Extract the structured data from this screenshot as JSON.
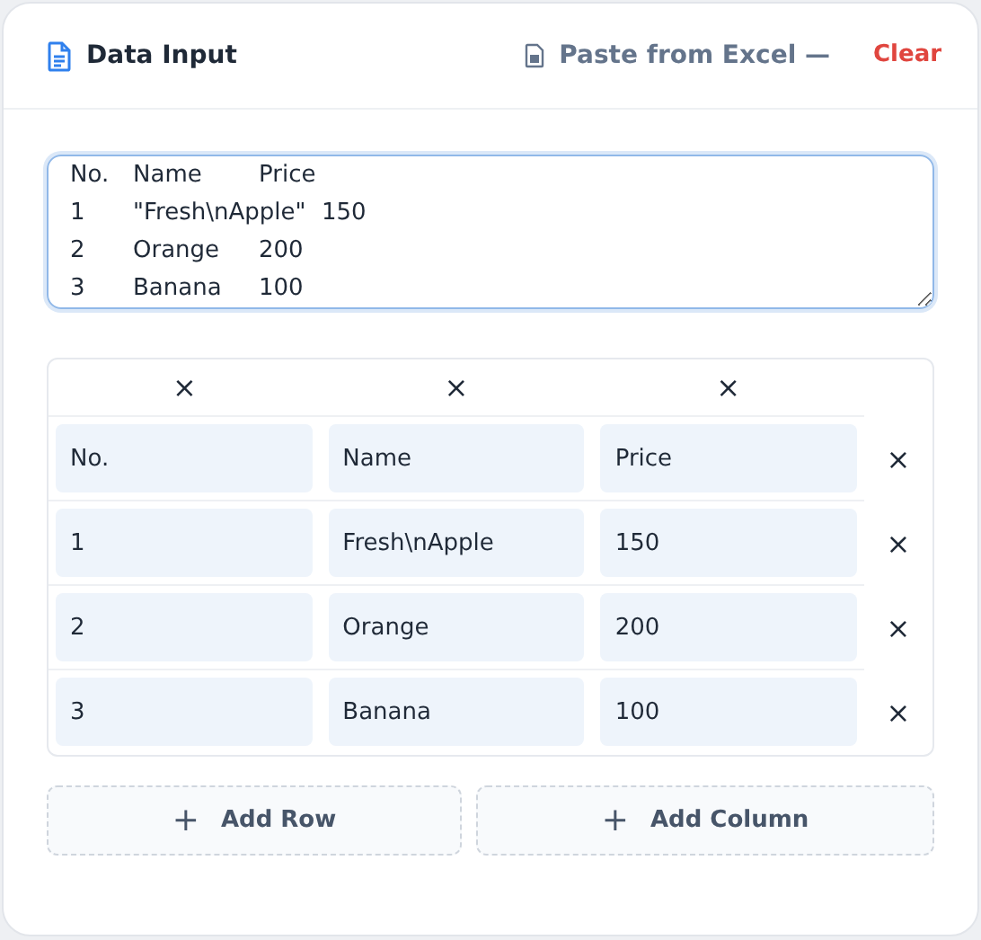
{
  "header": {
    "title": "Data Input",
    "paste_button": "Paste from Excel —",
    "clear_button": "Clear"
  },
  "paste_area": {
    "lines": [
      "No.\tName\tPrice",
      "1\t\"Fresh\\nApple\"\t150",
      "2\tOrange\t200",
      "3\tBanana\t100"
    ]
  },
  "table": {
    "column_remove": "×",
    "row_remove": "×",
    "rows": [
      [
        "No.",
        "Name",
        "Price"
      ],
      [
        "1",
        "Fresh\\nApple",
        "150"
      ],
      [
        "2",
        "Orange",
        "200"
      ],
      [
        "3",
        "Banana",
        "100"
      ]
    ]
  },
  "actions": [
    {
      "label": "Add Row",
      "icon": "+"
    },
    {
      "label": "Add Column",
      "icon": "+"
    }
  ]
}
